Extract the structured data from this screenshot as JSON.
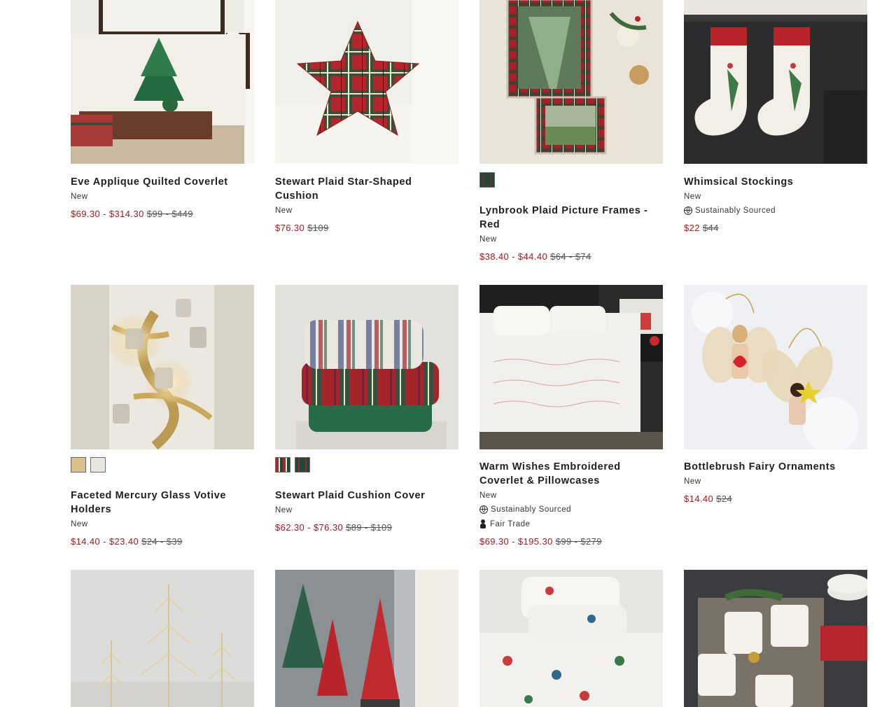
{
  "labels": {
    "new": "New",
    "sustainably_sourced": "Sustainably Sourced",
    "fair_trade": "Fair Trade"
  },
  "products": [
    {
      "name": "Eve Applique Quilted Coverlet",
      "badge": "New",
      "sale_price": "$69.30 - $314.30",
      "original_price": "$99 - $449",
      "swatches": []
    },
    {
      "name": "Stewart Plaid Star-Shaped Cushion",
      "badge": "New",
      "sale_price": "$76.30",
      "original_price": "$109",
      "swatches": []
    },
    {
      "name": "Lynbrook Plaid Picture Frames - Red",
      "badge": "New",
      "sale_price": "$38.40 - $44.40",
      "original_price": "$64 - $74",
      "swatches": [
        "#1f4a35"
      ]
    },
    {
      "name": "Whimsical Stockings",
      "badge": "New",
      "tags": [
        "Sustainably Sourced"
      ],
      "sale_price": "$22",
      "original_price": "$44",
      "swatches": []
    },
    {
      "name": "Faceted Mercury Glass Votive Holders",
      "badge": "New",
      "sale_price": "$14.40 - $23.40",
      "original_price": "$24 - $39",
      "swatches": [
        "#d9c08d",
        "#e7e5dc"
      ]
    },
    {
      "name": "Stewart Plaid Cushion Cover",
      "badge": "New",
      "sale_price": "$62.30 - $76.30",
      "original_price": "$89 - $109",
      "swatches": [
        "#9a2a30",
        "#1e4a3a"
      ]
    },
    {
      "name": "Warm Wishes Embroidered Coverlet & Pillowcases",
      "badge": "New",
      "tags": [
        "Sustainably Sourced",
        "Fair Trade"
      ],
      "sale_price": "$69.30 - $195.30",
      "original_price": "$99 - $279",
      "swatches": []
    },
    {
      "name": "Bottlebrush Fairy Ornaments",
      "badge": "New",
      "sale_price": "$14.40",
      "original_price": "$24",
      "swatches": []
    }
  ],
  "partial_row_images": [
    "lit-wire-trees",
    "red-berry-cone-trees",
    "gnome-print-bedding",
    "monogram-candles"
  ],
  "colors": {
    "sale": "#a6191d",
    "text": "#1f1f1f",
    "strike": "#555555"
  }
}
